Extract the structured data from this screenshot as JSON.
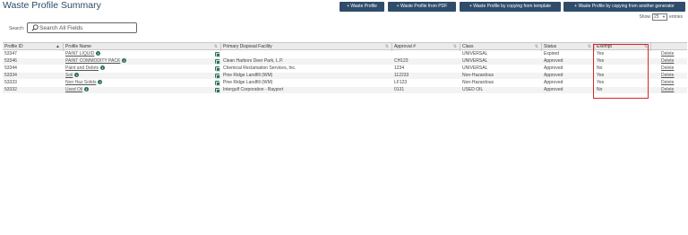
{
  "page": {
    "title": "Waste Profile Summary"
  },
  "actions": [
    {
      "label": "+ Waste Profile"
    },
    {
      "label": "+ Waste Profile from PDF"
    },
    {
      "label": "+ Waste Profile by copying from template"
    },
    {
      "label": "+ Waste Profile by copying from another generator"
    }
  ],
  "show_entries": {
    "prefix": "Show",
    "value": "25",
    "suffix": "entries"
  },
  "search": {
    "label": "Search:",
    "placeholder": "Search All Fields",
    "value": ""
  },
  "table": {
    "headers": [
      "Profile ID",
      "Profile Name",
      "Primary Disposal Facility",
      "Approval #",
      "Class",
      "Status",
      "Exempt",
      ""
    ],
    "rows": [
      {
        "id": "53347",
        "name": "PAINT LIQUID",
        "facility": "",
        "approval": "",
        "class": "UNIVERSAL",
        "status": "Expired",
        "exempt": "Yes",
        "action": "Delete"
      },
      {
        "id": "53346",
        "name": "PAINT COMMODITY PACK",
        "facility": "Clean Harbors Deer Park, L.P.",
        "approval": "CH123",
        "class": "UNIVERSAL",
        "status": "Approved",
        "exempt": "Yes",
        "action": "Delete"
      },
      {
        "id": "53344",
        "name": "Paint and Debris",
        "facility": "Chemical Reclamation Services, Inc.",
        "approval": "1234",
        "class": "UNIVERSAL",
        "status": "Approved",
        "exempt": "No",
        "action": "Delete"
      },
      {
        "id": "53334",
        "name": "Soil",
        "facility": "Pine Ridge Landfill (WM)",
        "approval": "112233",
        "class": "Non-Hazardous",
        "status": "Approved",
        "exempt": "Yes",
        "action": "Delete"
      },
      {
        "id": "53333",
        "name": "Non Haz Solids",
        "facility": "Pine Ridge Landfill (WM)",
        "approval": "LF123",
        "class": "Non-Hazardous",
        "status": "Approved",
        "exempt": "Yes",
        "action": "Delete"
      },
      {
        "id": "53332",
        "name": "Used Oil",
        "facility": "Intergulf Corporation - Bayport",
        "approval": "0131",
        "class": "USED OIL",
        "status": "Approved",
        "exempt": "No",
        "action": "Delete"
      }
    ]
  },
  "colors": {
    "button_bg": "#2f4d6b",
    "highlight": "#d9252a",
    "icon_green": "#2f6e5a"
  }
}
